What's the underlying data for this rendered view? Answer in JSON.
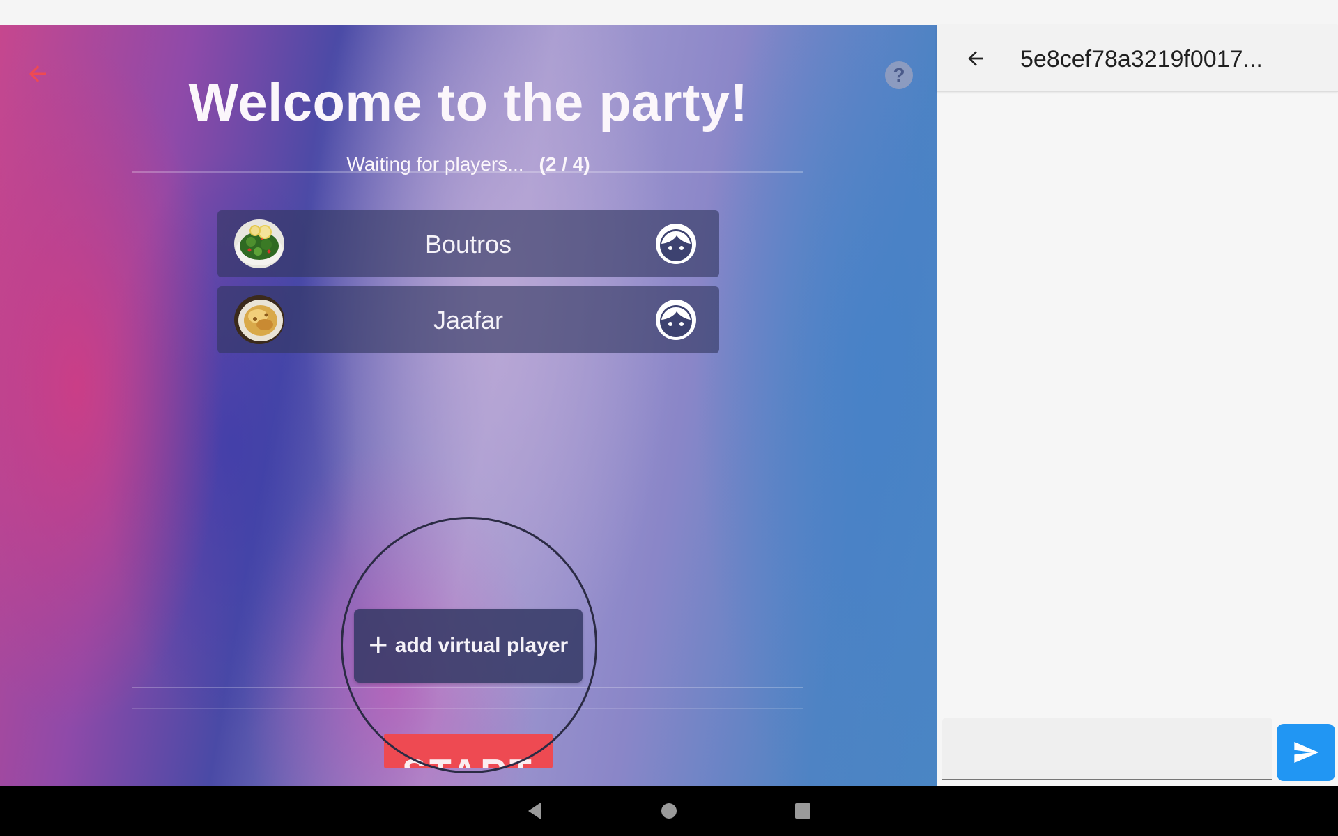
{
  "game": {
    "title": "Welcome to the party!",
    "waiting_text": "Waiting for players...",
    "player_count": "(2 / 4)",
    "players": [
      {
        "name": "Boutros",
        "avatar": "salad-photo"
      },
      {
        "name": "Jaafar",
        "avatar": "food-plate-photo"
      }
    ],
    "add_virtual_player_label": "add virtual player",
    "start_label": "START",
    "help_label": "?"
  },
  "chat": {
    "title": "5e8cef78a3219f0017...",
    "input_value": "",
    "input_placeholder": ""
  },
  "colors": {
    "accent_red": "#ee4a52",
    "send_blue": "#2196f3"
  },
  "icons": {
    "game_back": "arrow-left-icon",
    "help": "question-mark-icon",
    "player_type": "face-icon",
    "add": "plus-icon",
    "chat_back": "arrow-left-icon",
    "send": "send-icon",
    "nav": [
      "back-triangle-icon",
      "home-circle-icon",
      "recents-square-icon"
    ]
  }
}
